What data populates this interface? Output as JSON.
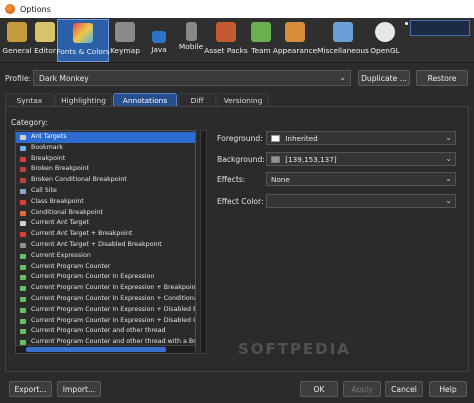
{
  "window": {
    "title": "Options"
  },
  "toolbar": {
    "items": [
      {
        "label": "General",
        "icon": "gear-wrench-icon",
        "color": "#d0a64a"
      },
      {
        "label": "Editor",
        "icon": "editor-icon",
        "color": "#d8c36a"
      },
      {
        "label": "Fonts & Colors",
        "icon": "fonts-colors-icon",
        "color": "#e04b4b"
      },
      {
        "label": "Keymap",
        "icon": "keyboard-icon",
        "color": "#9a9a9a"
      },
      {
        "label": "Java",
        "icon": "java-cup-icon",
        "color": "#2b74c7"
      },
      {
        "label": "Mobile",
        "icon": "mobile-phone-icon",
        "color": "#888888"
      },
      {
        "label": "Asset Packs",
        "icon": "asset-packs-icon",
        "color": "#c45a32"
      },
      {
        "label": "Team",
        "icon": "team-icon",
        "color": "#6bb04f"
      },
      {
        "label": "Appearance",
        "icon": "appearance-icon",
        "color": "#d98b3a"
      },
      {
        "label": "Miscellaneous",
        "icon": "miscellaneous-icon",
        "color": "#6aa0d8"
      },
      {
        "label": "OpenGL",
        "icon": "opengl-icon",
        "color": "#e8e8e8"
      }
    ]
  },
  "profile": {
    "label": "Profile:",
    "value": "Dark Monkey",
    "duplicate_label": "Duplicate ...",
    "restore_label": "Restore"
  },
  "tabs": [
    {
      "label": "Syntax"
    },
    {
      "label": "Highlighting"
    },
    {
      "label": "Annotations"
    },
    {
      "label": "Diff"
    },
    {
      "label": "Versioning"
    }
  ],
  "category": {
    "label": "Category:",
    "items": [
      {
        "label": "Ant Targets",
        "color": "#d0d0d0"
      },
      {
        "label": "Bookmark",
        "color": "#6ab0ff"
      },
      {
        "label": "Breakpoint",
        "color": "#e03b3b"
      },
      {
        "label": "Broken Breakpoint",
        "color": "#c04040"
      },
      {
        "label": "Broken Conditional Breakpoint",
        "color": "#c04040"
      },
      {
        "label": "Call Site",
        "color": "#8fa8d0"
      },
      {
        "label": "Class Breakpoint",
        "color": "#e03b3b"
      },
      {
        "label": "Conditional Breakpoint",
        "color": "#e06a3b"
      },
      {
        "label": "Current Ant Target",
        "color": "#d0d0d0"
      },
      {
        "label": "Current Ant Target + Breakpoint",
        "color": "#e03b3b"
      },
      {
        "label": "Current Ant Target + Disabled Breakpoint",
        "color": "#909090"
      },
      {
        "label": "Current Expression",
        "color": "#6ac06a"
      },
      {
        "label": "Current Program Counter",
        "color": "#6ac06a"
      },
      {
        "label": "Current Program Counter In Expression",
        "color": "#6ac06a"
      },
      {
        "label": "Current Program Counter In Expression + Breakpoint",
        "color": "#6ac06a"
      },
      {
        "label": "Current Program Counter In Expression + Conditional Brea",
        "color": "#6ac06a"
      },
      {
        "label": "Current Program Counter In Expression + Disabled Break",
        "color": "#6ac06a"
      },
      {
        "label": "Current Program Counter In Expression + Disabled Condi",
        "color": "#6ac06a"
      },
      {
        "label": "Current Program Counter and other thread",
        "color": "#6ac06a"
      },
      {
        "label": "Current Program Counter and other thread with a Breakpo",
        "color": "#6ac06a"
      }
    ]
  },
  "properties": {
    "foreground": {
      "label": "Foreground:",
      "value": "Inherited"
    },
    "background": {
      "label": "Background:",
      "value": "[139,153,137]",
      "swatch": "#8b9989"
    },
    "effects": {
      "label": "Effects:",
      "value": "None"
    },
    "effect_color": {
      "label": "Effect Color:",
      "value": ""
    }
  },
  "watermark": "SOFTPEDIA",
  "footer": {
    "export_label": "Export...",
    "import_label": "Import...",
    "ok_label": "OK",
    "apply_label": "Apply",
    "cancel_label": "Cancel",
    "help_label": "Help"
  }
}
